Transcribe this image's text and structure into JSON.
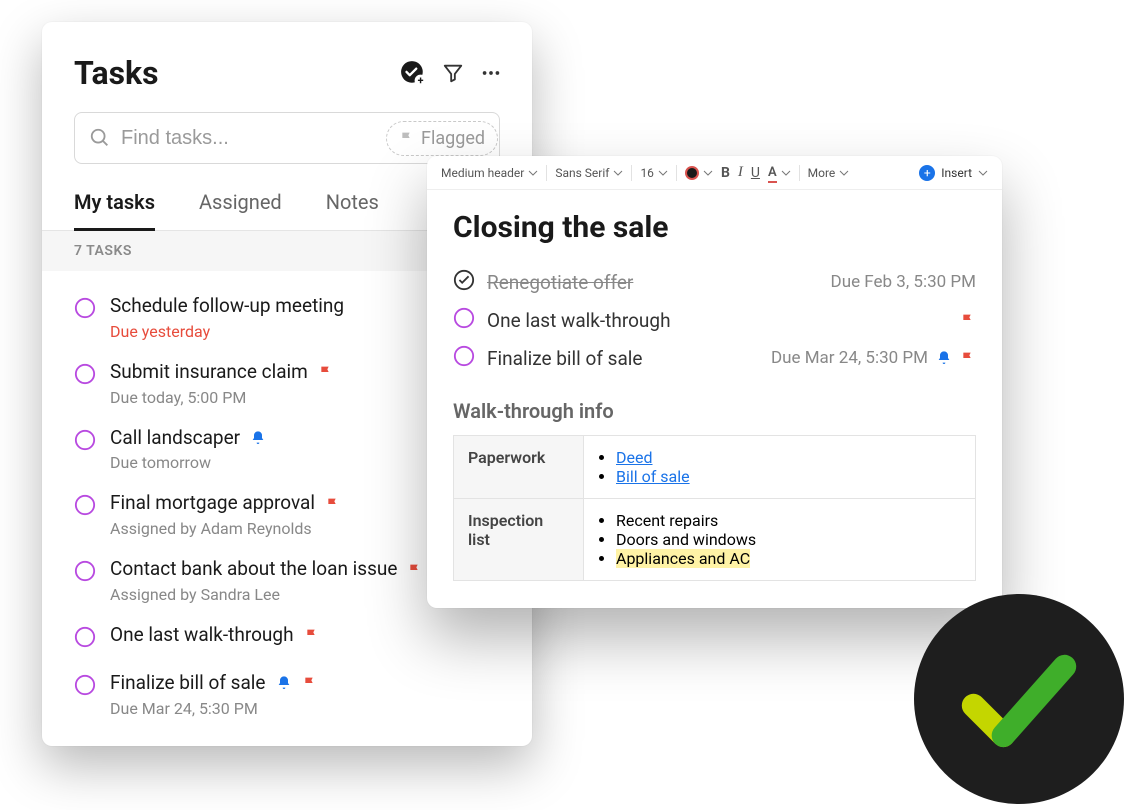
{
  "tasks_panel": {
    "title": "Tasks",
    "search_placeholder": "Find tasks...",
    "flagged_label": "Flagged",
    "tabs": {
      "my_tasks": "My tasks",
      "assigned": "Assigned",
      "notes": "Notes"
    },
    "count_label": "7 TASKS",
    "items": [
      {
        "title": "Schedule follow-up meeting",
        "sub": "Due yesterday"
      },
      {
        "title": "Submit insurance claim",
        "sub": "Due today, 5:00 PM"
      },
      {
        "title": "Call landscaper",
        "sub": "Due tomorrow"
      },
      {
        "title": "Final mortgage approval",
        "sub": "Assigned by Adam Reynolds"
      },
      {
        "title": "Contact bank about the loan issue",
        "sub": "Assigned by Sandra Lee"
      },
      {
        "title": "One last walk-through",
        "sub": ""
      },
      {
        "title": "Finalize bill of sale",
        "sub": "Due Mar 24, 5:30 PM"
      }
    ]
  },
  "note_panel": {
    "toolbar": {
      "heading": "Medium header",
      "font": "Sans Serif",
      "size": "16",
      "more": "More",
      "insert": "Insert"
    },
    "title": "Closing the sale",
    "tasks": [
      {
        "title": "Renegotiate offer",
        "due": "Due Feb 3, 5:30 PM"
      },
      {
        "title": "One last walk-through",
        "due": ""
      },
      {
        "title": "Finalize bill of sale",
        "due": "Due Mar 24, 5:30 PM"
      }
    ],
    "subhead": "Walk-through info",
    "table": {
      "rows": [
        {
          "label": "Paperwork",
          "items": [
            "Deed",
            "Bill of sale"
          ]
        },
        {
          "label": "Inspection list",
          "items": [
            "Recent repairs",
            "Doors and windows",
            "Appliances and AC"
          ]
        }
      ]
    }
  }
}
